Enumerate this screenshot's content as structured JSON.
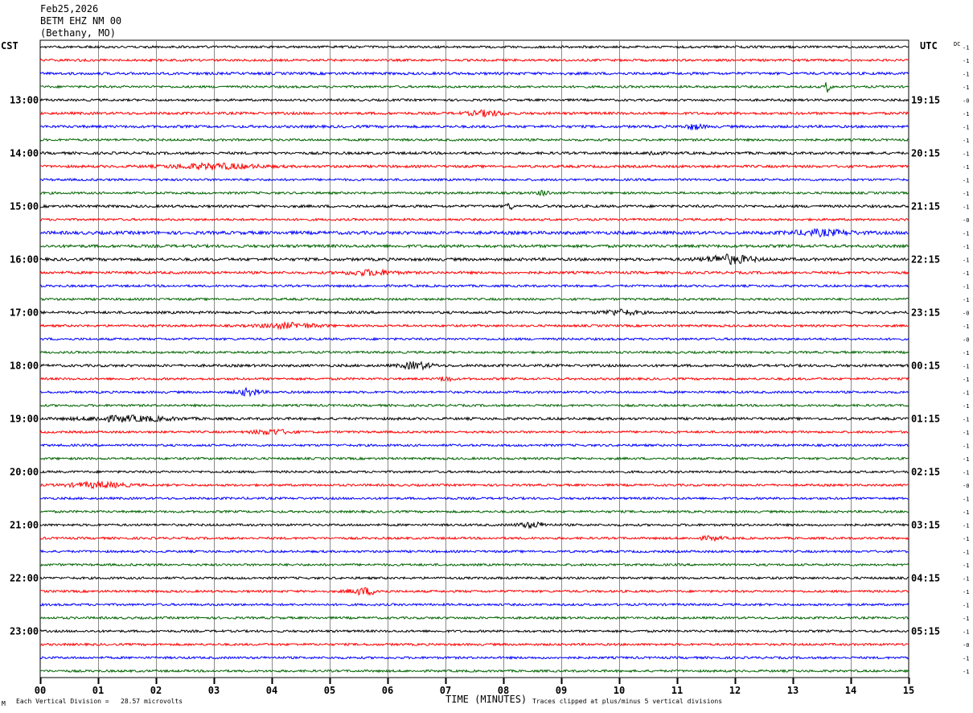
{
  "header": {
    "date": "Feb25,2026",
    "station": "BETM EHZ NM 00",
    "location": "(Bethany, MO)"
  },
  "left_zone": "CST",
  "right_zone": "UTC",
  "dc_label": "DC",
  "footer": {
    "division": "Each Vertical Division =   28.57 microvolts",
    "xlabel": "TIME (MINUTES)",
    "clip_note": "Traces clipped at plus/minus 5 vertical divisions",
    "corner_mark": "M"
  },
  "colors": {
    "trace_cycle": [
      "#000000",
      "#ff0000",
      "#0000ff",
      "#006400"
    ],
    "grid": "#8a8a8a"
  },
  "chart_data": {
    "type": "line",
    "title": "BETM EHZ NM 00 (Bethany, MO) Feb25,2026",
    "xlabel": "TIME (MINUTES)",
    "xlim": [
      0,
      15
    ],
    "x_ticks": [
      "00",
      "01",
      "02",
      "03",
      "04",
      "05",
      "06",
      "07",
      "08",
      "09",
      "10",
      "11",
      "12",
      "13",
      "14",
      "15"
    ],
    "rows": 48,
    "minutes_per_row": 15,
    "first_row_start_cst": "12:15",
    "left_hour_labels": [
      "13:00",
      "14:00",
      "15:00",
      "16:00",
      "17:00",
      "18:00",
      "19:00",
      "20:00",
      "21:00",
      "22:00",
      "23:00"
    ],
    "right_hour_labels": [
      "19:15",
      "20:15",
      "21:15",
      "22:15",
      "23:15",
      "00:15",
      "01:15",
      "02:15",
      "03:15",
      "04:15",
      "05:15"
    ],
    "hour_label_rows": [
      4,
      8,
      12,
      16,
      20,
      24,
      28,
      32,
      36,
      40,
      44
    ],
    "dc_offsets": [
      "-1",
      "-1",
      "-1",
      "-1",
      "-0",
      "-1",
      "-1",
      "-1",
      "-1",
      "-1",
      "-1",
      "-1",
      "-1",
      "-0",
      "-1",
      "-1",
      "-1",
      "-1",
      "-1",
      "-1",
      "-0",
      "-1",
      "-0",
      "-1",
      "-1",
      "-1",
      "-1",
      "-1",
      "-1",
      "-1",
      "-1",
      "-1",
      "-1",
      "-0",
      "-1",
      "-1",
      "-1",
      "-1",
      "-1",
      "-1",
      "-1",
      "-1",
      "-1",
      "-1",
      "-1",
      "-0",
      "-1",
      "-1"
    ],
    "noise_level": [
      1.4,
      1.4,
      1.6,
      1.4,
      1.4,
      1.6,
      1.6,
      1.4,
      1.6,
      1.6,
      1.4,
      1.4,
      1.6,
      1.4,
      2.0,
      1.8,
      1.8,
      1.6,
      1.4,
      1.4,
      1.6,
      1.4,
      1.4,
      1.4,
      1.6,
      1.4,
      1.4,
      1.4,
      1.6,
      1.4,
      1.4,
      1.4,
      1.4,
      1.4,
      1.4,
      1.4,
      1.4,
      1.4,
      1.4,
      1.4,
      1.4,
      1.4,
      1.4,
      1.4,
      1.4,
      1.4,
      1.4,
      1.4
    ],
    "bursts": [
      {
        "row": 3,
        "minute": 13.6,
        "amplitude": 7,
        "width_min": 0.1
      },
      {
        "row": 5,
        "minute": 7.7,
        "amplitude": 3,
        "width_min": 0.6
      },
      {
        "row": 6,
        "minute": 11.3,
        "amplitude": 3,
        "width_min": 0.3
      },
      {
        "row": 8,
        "minute": 10.6,
        "amplitude": 3,
        "width_min": 0.2
      },
      {
        "row": 9,
        "minute": 3.0,
        "amplitude": 3,
        "width_min": 1.5
      },
      {
        "row": 11,
        "minute": 8.7,
        "amplitude": 3,
        "width_min": 0.2
      },
      {
        "row": 12,
        "minute": 8.1,
        "amplitude": 5,
        "width_min": 0.1
      },
      {
        "row": 14,
        "minute": 13.5,
        "amplitude": 3,
        "width_min": 1.0
      },
      {
        "row": 16,
        "minute": 11.9,
        "amplitude": 5,
        "width_min": 0.8
      },
      {
        "row": 17,
        "minute": 5.7,
        "amplitude": 3,
        "width_min": 0.8
      },
      {
        "row": 20,
        "minute": 10.0,
        "amplitude": 3,
        "width_min": 0.6
      },
      {
        "row": 21,
        "minute": 4.3,
        "amplitude": 3,
        "width_min": 1.0
      },
      {
        "row": 24,
        "minute": 6.5,
        "amplitude": 4,
        "width_min": 0.5
      },
      {
        "row": 25,
        "minute": 7.0,
        "amplitude": 3,
        "width_min": 0.2
      },
      {
        "row": 26,
        "minute": 3.6,
        "amplitude": 4,
        "width_min": 0.4
      },
      {
        "row": 28,
        "minute": 1.5,
        "amplitude": 3,
        "width_min": 1.5
      },
      {
        "row": 29,
        "minute": 4.0,
        "amplitude": 3,
        "width_min": 0.6
      },
      {
        "row": 33,
        "minute": 1.0,
        "amplitude": 3,
        "width_min": 1.0
      },
      {
        "row": 36,
        "minute": 8.5,
        "amplitude": 3,
        "width_min": 0.5
      },
      {
        "row": 37,
        "minute": 11.6,
        "amplitude": 2,
        "width_min": 0.4
      },
      {
        "row": 41,
        "minute": 5.6,
        "amplitude": 4,
        "width_min": 0.5
      }
    ]
  }
}
